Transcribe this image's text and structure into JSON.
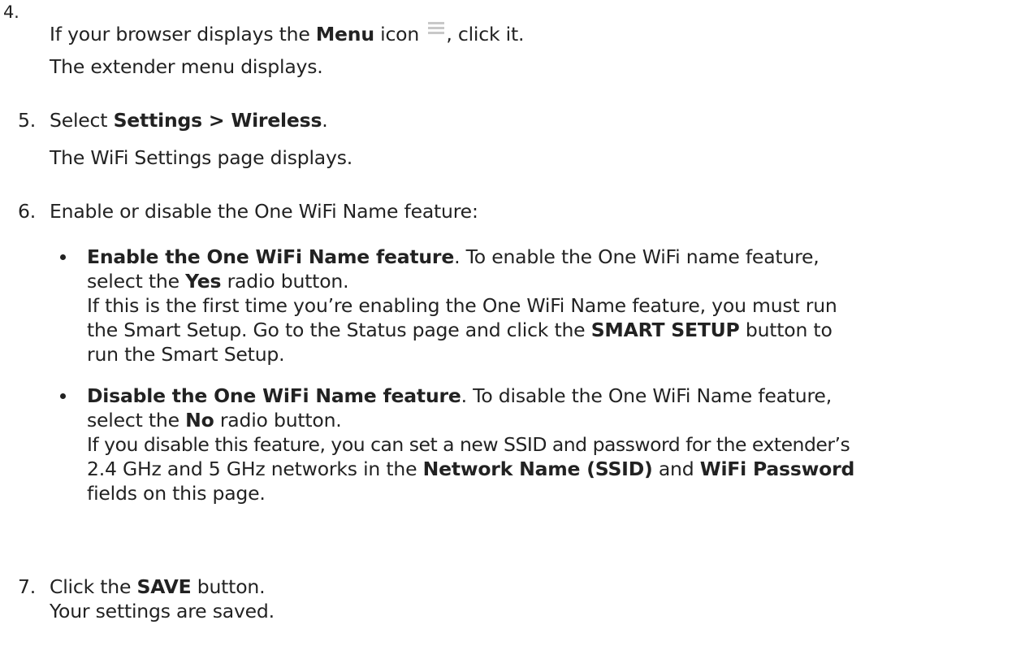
{
  "step4": {
    "number": "4.",
    "line1_pre": "If your browser displays the ",
    "line1_bold": "Menu",
    "line1_mid": " icon ",
    "line1_post": ", click it.",
    "line2": "The extender menu displays."
  },
  "step5": {
    "number": "5.",
    "line1_pre": "Select ",
    "line1_bold": "Settings > Wireless",
    "line1_post": ".",
    "line2": "The WiFi Settings page displays."
  },
  "step6": {
    "number": "6.",
    "line1": "Enable or disable the One WiFi Name feature:",
    "bullet1": {
      "l1_bold": "Enable the One WiFi Name feature",
      "l1_post": ". To enable the One WiFi name feature,",
      "l2_pre": "select the ",
      "l2_bold": "Yes",
      "l2_post": " radio button.",
      "l3": "If this is the first time you’re enabling the One WiFi Name feature, you must run",
      "l4_pre": "the Smart Setup. Go to the Status page and click the ",
      "l4_bold": "SMART SETUP",
      "l4_post": " button to",
      "l5": "run the Smart Setup."
    },
    "bullet2": {
      "l1_bold": "Disable the One WiFi Name feature",
      "l1_post": ". To disable the One WiFi Name feature,",
      "l2_pre": "select the ",
      "l2_bold": "No",
      "l2_post": " radio button.",
      "l3": "If you disable this feature, you can set a new SSID and password for the extender’s",
      "l4_pre": "2.4 GHz and 5 GHz networks in the ",
      "l4_bold1": "Network Name (SSID)",
      "l4_mid": " and ",
      "l4_bold2": "WiFi Password",
      "l5": "fields on this page."
    }
  },
  "step7": {
    "number": "7.",
    "line1_pre": "Click the ",
    "line1_bold": "SAVE",
    "line1_post": " button.",
    "line2": "Your settings are saved."
  },
  "icons": {
    "menu": "hamburger-menu-icon"
  },
  "colors": {
    "text": "#222222",
    "icon": "#c8c8c8"
  }
}
